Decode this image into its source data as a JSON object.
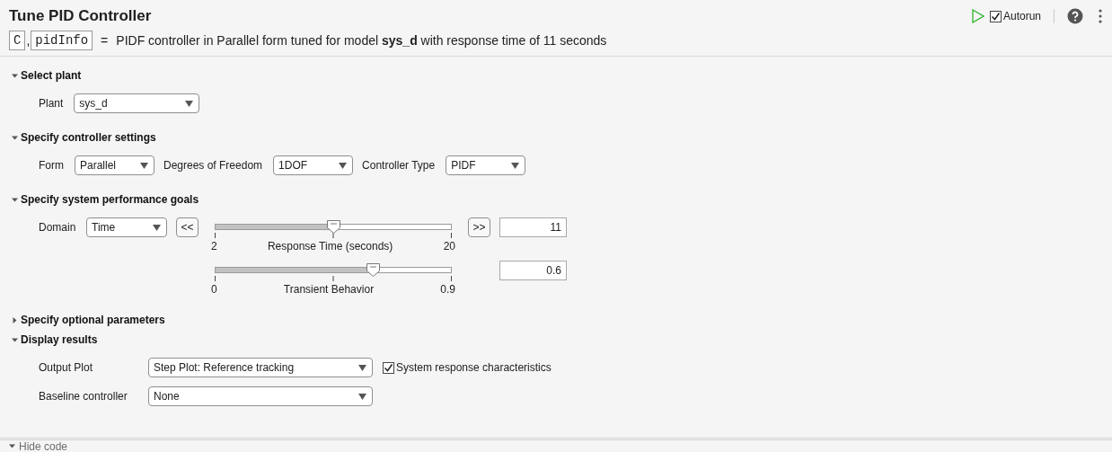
{
  "title": "Tune PID Controller",
  "toolbar": {
    "autorun": {
      "label": "Autorun",
      "checked": true
    }
  },
  "summary": {
    "outputs": [
      "C",
      "pidInfo"
    ],
    "separator": ",",
    "equals": "=",
    "text": "PIDF controller in Parallel form tuned for model **sys_d** with response time of 11 seconds"
  },
  "sections": [
    {
      "kind": "fields",
      "title": "Select plant",
      "expanded": true,
      "fields": [
        {
          "label": "Plant",
          "value": "sys_d"
        }
      ]
    },
    {
      "kind": "fields",
      "title": "Specify controller settings",
      "expanded": true,
      "fields": [
        {
          "label": "Form",
          "value": "Parallel"
        },
        {
          "label": "Degrees of Freedom",
          "value": "1DOF"
        },
        {
          "label": "Controller Type",
          "value": "PIDF"
        }
      ]
    },
    {
      "kind": "goals",
      "title": "Specify system performance goals",
      "expanded": true,
      "domain": {
        "label": "Domain",
        "value": "Time"
      },
      "step_buttons": [
        "<<",
        ">>"
      ],
      "sliders": [
        {
          "min": "2",
          "max": "20",
          "label": "Response Time (seconds)",
          "level": 0.5,
          "value": "11"
        },
        {
          "min": "0",
          "max": "0.9",
          "label": "Transient Behavior",
          "level": 0.667,
          "value": "0.6"
        }
      ]
    },
    {
      "title": "Specify optional parameters",
      "expanded": false
    },
    {
      "kind": "grid",
      "title": "Display results",
      "expanded": true,
      "rows": [
        {
          "label": "Output Plot",
          "value": "Step Plot: Reference tracking",
          "checkbox": {
            "label": "System response characteristics",
            "checked": true
          }
        },
        {
          "label": "Baseline controller",
          "value": "None"
        }
      ]
    }
  ],
  "footer": {
    "label": "Hide code",
    "expanded": true
  }
}
